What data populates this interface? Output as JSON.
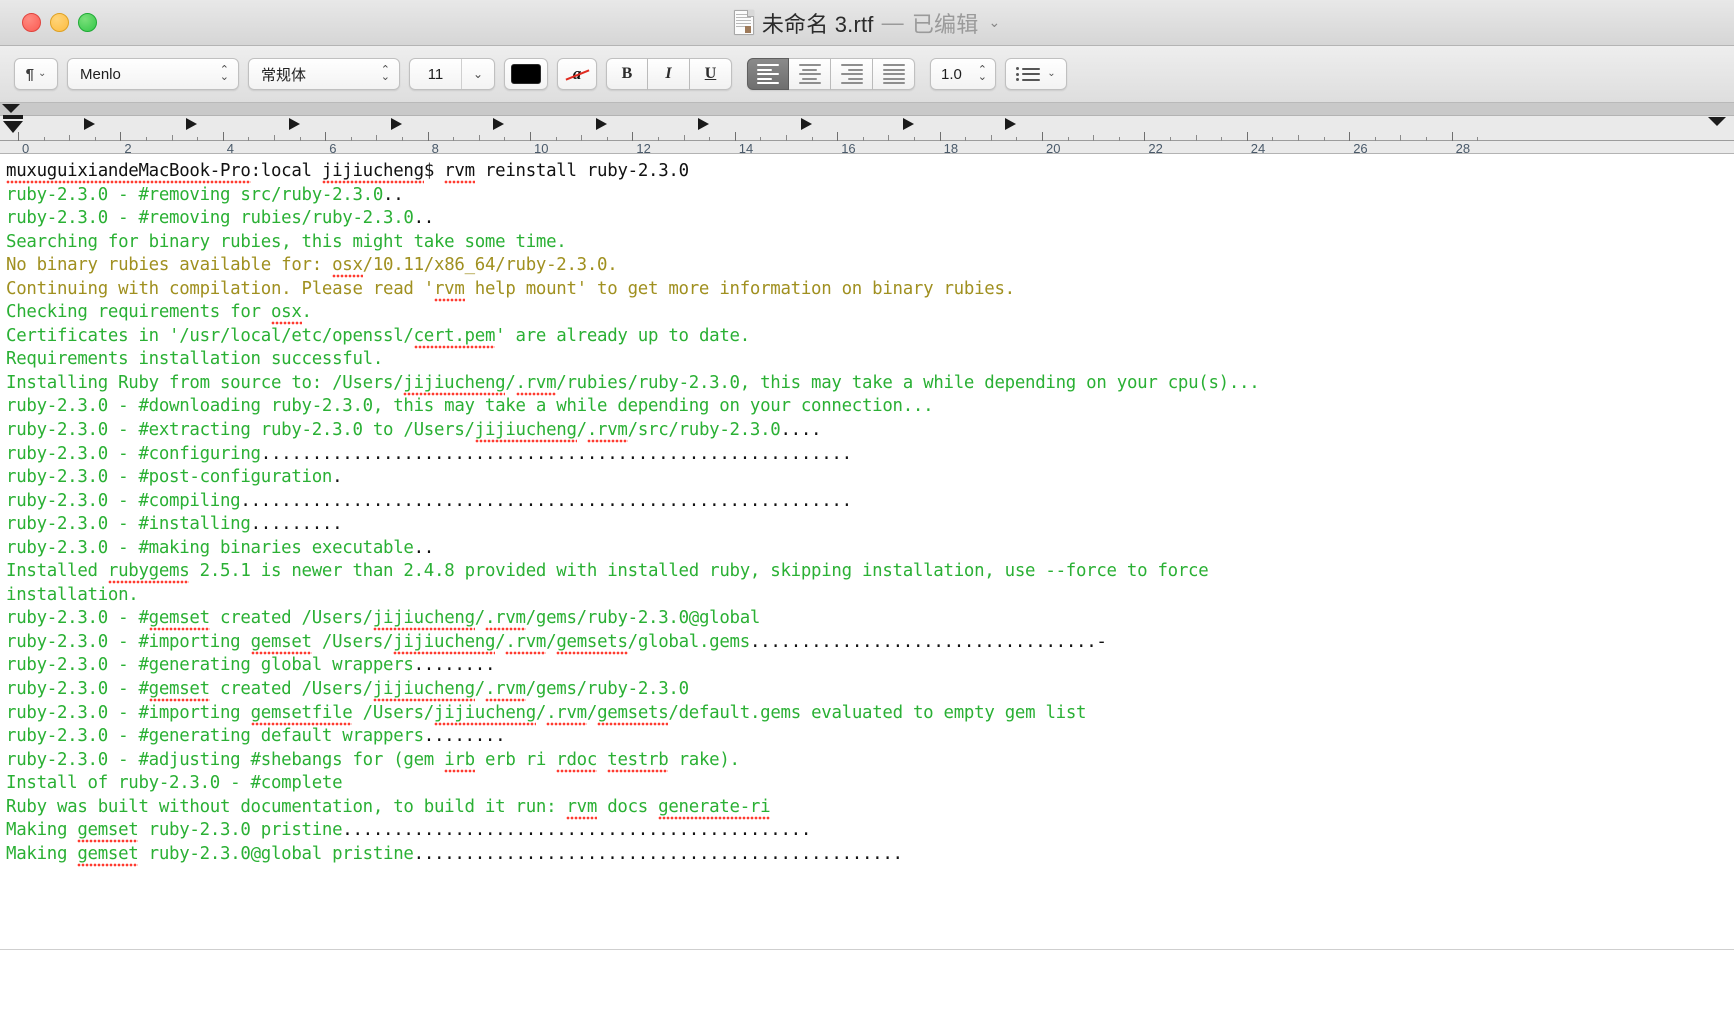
{
  "window": {
    "title_main": "未命名 3.rtf",
    "title_sep": "—",
    "title_status": "已编辑",
    "title_chevron": "⌄",
    "traffic": {
      "close": "close-button",
      "minimize": "minimize-button",
      "maximize": "maximize-button"
    }
  },
  "toolbar": {
    "paragraph_glyph": "¶",
    "chevron": "⌄",
    "font_family": "Menlo",
    "font_style": "常规体",
    "font_size": "11",
    "stepper": "⌃⌄",
    "text_color_hex": "#000000",
    "strike_a": "a",
    "bold": "B",
    "italic": "I",
    "underline": "U",
    "align_left": "align-left",
    "align_center": "align-center",
    "align_right": "align-right",
    "align_justify": "align-justify",
    "align_active": "align-left",
    "line_spacing": "1.0",
    "list_label": "list"
  },
  "ruler": {
    "unit_max": 28,
    "numbers": [
      "0",
      "2",
      "4",
      "6",
      "8",
      "10",
      "12",
      "14",
      "16",
      "18",
      "20",
      "22",
      "24",
      "26",
      "28"
    ],
    "tab_stops": [
      0.6,
      2.6,
      4.6,
      6.6,
      8.6,
      10.6,
      12.6,
      14.6,
      16.6,
      18.6
    ],
    "indent_marker": 0
  },
  "document": {
    "selected_color_hex": "#2ab034",
    "alt_color_hex": "#a09020",
    "lines": [
      {
        "id": "line-1",
        "color": "black",
        "parts": [
          {
            "t": "muxuguixiandeMacBook-Pro",
            "sp": true
          },
          {
            "t": ":local "
          },
          {
            "t": "jijiucheng",
            "sp": true
          },
          {
            "t": "$ "
          },
          {
            "t": "rvm",
            "sp": true
          },
          {
            "t": " reinstall ruby-2.3.0"
          }
        ]
      },
      {
        "id": "line-2",
        "color": "green",
        "parts": [
          {
            "t": "ruby-2.3.0 - #removing src/ruby-2.3.0"
          },
          {
            "t": "..",
            "dots": true
          }
        ]
      },
      {
        "id": "line-3",
        "color": "green",
        "parts": [
          {
            "t": "ruby-2.3.0 - #removing rubies/ruby-2.3.0"
          },
          {
            "t": "..",
            "dots": true
          }
        ]
      },
      {
        "id": "line-4",
        "color": "green",
        "parts": [
          {
            "t": "Searching for binary rubies, this might take some time."
          }
        ]
      },
      {
        "id": "line-5",
        "color": "olive",
        "parts": [
          {
            "t": "No binary rubies available for: "
          },
          {
            "t": "osx",
            "sp": true
          },
          {
            "t": "/10.11/x86_64/ruby-2.3.0."
          }
        ]
      },
      {
        "id": "line-6",
        "color": "olive",
        "parts": [
          {
            "t": "Continuing with compilation. Please read '"
          },
          {
            "t": "rvm",
            "sp": true
          },
          {
            "t": " help mount' to get more information on binary rubies."
          }
        ]
      },
      {
        "id": "line-7",
        "color": "green",
        "parts": [
          {
            "t": "Checking requirements for "
          },
          {
            "t": "osx",
            "sp": true
          },
          {
            "t": "."
          }
        ]
      },
      {
        "id": "line-8",
        "color": "green",
        "parts": [
          {
            "t": "Certificates in '/usr/local/etc/openssl/"
          },
          {
            "t": "cert.pem",
            "sp": true
          },
          {
            "t": "' are already up to date."
          }
        ]
      },
      {
        "id": "line-9",
        "color": "green",
        "parts": [
          {
            "t": "Requirements installation successful."
          }
        ]
      },
      {
        "id": "line-10",
        "color": "green",
        "parts": [
          {
            "t": "Installing Ruby from source to: /Users/"
          },
          {
            "t": "jijiucheng",
            "sp": true
          },
          {
            "t": "/"
          },
          {
            "t": ".rvm",
            "sp": true
          },
          {
            "t": "/rubies/ruby-2.3.0, this may take a while depending on your cpu(s)..."
          }
        ]
      },
      {
        "id": "line-11",
        "color": "green",
        "parts": [
          {
            "t": "ruby-2.3.0 - #downloading ruby-2.3.0, this may take a while depending on your connection..."
          }
        ]
      },
      {
        "id": "line-12",
        "color": "green",
        "parts": [
          {
            "t": "ruby-2.3.0 - #extracting ruby-2.3.0 to /Users/"
          },
          {
            "t": "jijiucheng",
            "sp": true
          },
          {
            "t": "/"
          },
          {
            "t": ".rvm",
            "sp": true
          },
          {
            "t": "/src/ruby-2.3.0"
          },
          {
            "t": "....",
            "dots": true
          }
        ]
      },
      {
        "id": "line-13",
        "color": "green",
        "parts": [
          {
            "t": "ruby-2.3.0 - #configuring"
          },
          {
            "t": "..........................................................",
            "dots": true
          }
        ]
      },
      {
        "id": "line-14",
        "color": "green",
        "parts": [
          {
            "t": "ruby-2.3.0 - #post-configuration"
          },
          {
            "t": ".",
            "dots": true
          }
        ]
      },
      {
        "id": "line-15",
        "color": "green",
        "parts": [
          {
            "t": "ruby-2.3.0 - #compiling"
          },
          {
            "t": "............................................................",
            "dots": true
          }
        ]
      },
      {
        "id": "line-16",
        "color": "green",
        "parts": [
          {
            "t": "ruby-2.3.0 - #installing"
          },
          {
            "t": ".........",
            "dots": true
          }
        ]
      },
      {
        "id": "line-17",
        "color": "green",
        "parts": [
          {
            "t": "ruby-2.3.0 - #making binaries executable"
          },
          {
            "t": "..",
            "dots": true
          }
        ]
      },
      {
        "id": "line-18",
        "color": "green",
        "parts": [
          {
            "t": "Installed "
          },
          {
            "t": "rubygems",
            "sp": true
          },
          {
            "t": " 2.5.1 is newer than 2.4.8 provided with installed ruby, skipping installation, use --force to force"
          }
        ]
      },
      {
        "id": "line-19",
        "color": "green",
        "parts": [
          {
            "t": "installation."
          }
        ]
      },
      {
        "id": "line-20",
        "color": "green",
        "parts": [
          {
            "t": "ruby-2.3.0 - #"
          },
          {
            "t": "gemset",
            "sp": true
          },
          {
            "t": " created /Users/"
          },
          {
            "t": "jijiucheng",
            "sp": true
          },
          {
            "t": "/"
          },
          {
            "t": ".rvm",
            "sp": true
          },
          {
            "t": "/gems/ruby-2.3.0@global"
          }
        ]
      },
      {
        "id": "line-21",
        "color": "green",
        "parts": [
          {
            "t": "ruby-2.3.0 - #importing "
          },
          {
            "t": "gemset",
            "sp": true
          },
          {
            "t": " /Users/"
          },
          {
            "t": "jijiucheng",
            "sp": true
          },
          {
            "t": "/"
          },
          {
            "t": ".rvm",
            "sp": true
          },
          {
            "t": "/"
          },
          {
            "t": "gemsets",
            "sp": true
          },
          {
            "t": "/global.gems"
          },
          {
            "t": "..................................-",
            "dots": true
          }
        ]
      },
      {
        "id": "line-22",
        "color": "green",
        "parts": [
          {
            "t": "ruby-2.3.0 - #generating global wrappers"
          },
          {
            "t": "........",
            "dots": true
          }
        ]
      },
      {
        "id": "line-23",
        "color": "green",
        "parts": [
          {
            "t": "ruby-2.3.0 - #"
          },
          {
            "t": "gemset",
            "sp": true
          },
          {
            "t": " created /Users/"
          },
          {
            "t": "jijiucheng",
            "sp": true
          },
          {
            "t": "/"
          },
          {
            "t": ".rvm",
            "sp": true
          },
          {
            "t": "/gems/ruby-2.3.0"
          }
        ]
      },
      {
        "id": "line-24",
        "color": "green",
        "parts": [
          {
            "t": "ruby-2.3.0 - #importing "
          },
          {
            "t": "gemsetfile",
            "sp": true
          },
          {
            "t": " /Users/"
          },
          {
            "t": "jijiucheng",
            "sp": true
          },
          {
            "t": "/"
          },
          {
            "t": ".rvm",
            "sp": true
          },
          {
            "t": "/"
          },
          {
            "t": "gemsets",
            "sp": true
          },
          {
            "t": "/default.gems evaluated to empty gem list"
          }
        ]
      },
      {
        "id": "line-25",
        "color": "green",
        "parts": [
          {
            "t": "ruby-2.3.0 - #generating default wrappers"
          },
          {
            "t": "........",
            "dots": true
          }
        ]
      },
      {
        "id": "line-26",
        "color": "green",
        "parts": [
          {
            "t": "ruby-2.3.0 - #adjusting #shebangs for (gem "
          },
          {
            "t": "irb",
            "sp": true
          },
          {
            "t": " erb ri "
          },
          {
            "t": "rdoc",
            "sp": true
          },
          {
            "t": " "
          },
          {
            "t": "testrb",
            "sp": true
          },
          {
            "t": " rake)."
          }
        ]
      },
      {
        "id": "line-27",
        "color": "green",
        "parts": [
          {
            "t": "Install of ruby-2.3.0 - #complete"
          }
        ]
      },
      {
        "id": "line-28",
        "color": "green",
        "parts": [
          {
            "t": "Ruby was built without documentation, to build it run: "
          },
          {
            "t": "rvm",
            "sp": true
          },
          {
            "t": " docs "
          },
          {
            "t": "generate-ri",
            "sp": true
          }
        ]
      },
      {
        "id": "line-29",
        "color": "green",
        "parts": [
          {
            "t": "Making "
          },
          {
            "t": "gemset",
            "sp": true
          },
          {
            "t": " ruby-2.3.0 pristine"
          },
          {
            "t": "..............................................",
            "dots": true
          }
        ]
      },
      {
        "id": "line-30",
        "color": "green",
        "parts": [
          {
            "t": "Making "
          },
          {
            "t": "gemset",
            "sp": true
          },
          {
            "t": " ruby-2.3.0@global pristine"
          },
          {
            "t": "................................................",
            "dots": true
          }
        ]
      }
    ]
  }
}
